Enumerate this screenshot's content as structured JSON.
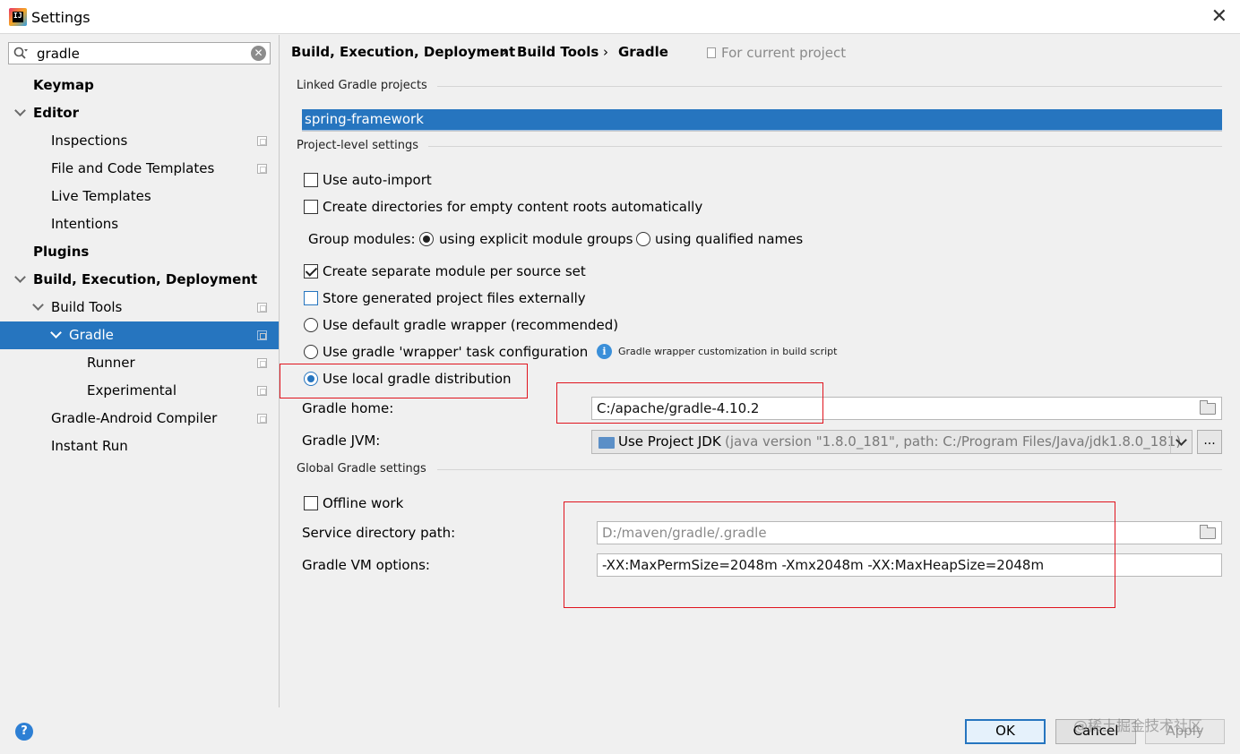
{
  "window": {
    "title": "Settings"
  },
  "search": {
    "value": "gradle"
  },
  "tree": [
    {
      "label": "Keymap"
    },
    {
      "label": "Editor"
    },
    {
      "label": "Inspections"
    },
    {
      "label": "File and Code Templates"
    },
    {
      "label": "Live Templates"
    },
    {
      "label": "Intentions"
    },
    {
      "label": "Plugins"
    },
    {
      "label": "Build, Execution, Deployment"
    },
    {
      "label": "Build Tools"
    },
    {
      "label": "Gradle"
    },
    {
      "label": "Runner"
    },
    {
      "label": "Experimental"
    },
    {
      "label": "Gradle-Android Compiler"
    },
    {
      "label": "Instant Run"
    }
  ],
  "breadcrumb": {
    "part1": "Build, Execution, Deployment",
    "part2": "Build Tools",
    "part3": "Gradle",
    "sep": "›",
    "scope": "For current project"
  },
  "linked": {
    "title": "Linked Gradle projects",
    "project": "spring-framework"
  },
  "project_settings": {
    "title": "Project-level settings",
    "auto_import": "Use auto-import",
    "create_dirs": "Create directories for empty content roots automatically",
    "group_modules": "Group modules:",
    "group_explicit": "using explicit module groups",
    "group_qualified": "using qualified names",
    "separate_module": "Create separate module per source set",
    "store_external": "Store generated project files externally",
    "default_wrapper": "Use default gradle wrapper (recommended)",
    "wrapper_task": "Use gradle 'wrapper' task configuration",
    "wrapper_hint": "Gradle wrapper customization in build script",
    "local_dist": "Use local gradle distribution",
    "gradle_home_label": "Gradle home:",
    "gradle_home_value": "C:/apache/gradle-4.10.2",
    "gradle_jvm_label": "Gradle JVM:",
    "jvm_selected": "Use Project JDK",
    "jvm_detail": "(java version \"1.8.0_181\", path: C:/Program Files/Java/jdk1.8.0_181)",
    "jvm_more": "..."
  },
  "global_settings": {
    "title": "Global Gradle settings",
    "offline": "Offline work",
    "service_dir_label": "Service directory path:",
    "service_dir_value": "D:/maven/gradle/.gradle",
    "vm_options_label": "Gradle VM options:",
    "vm_options_value": "-XX:MaxPermSize=2048m -Xmx2048m -XX:MaxHeapSize=2048m"
  },
  "footer": {
    "help": "?",
    "ok": "OK",
    "cancel": "Cancel",
    "apply": "Apply",
    "watermark": "@稀土掘金技术社区"
  },
  "colors": {
    "selection": "#2675bf",
    "annotation": "#e0141e"
  }
}
